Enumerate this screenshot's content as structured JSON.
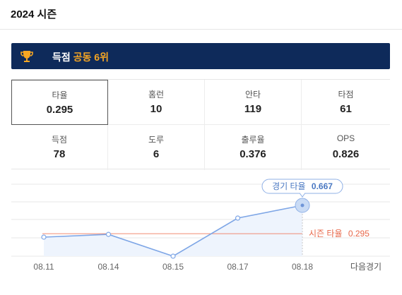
{
  "header": {
    "title": "2024 시즌"
  },
  "rank": {
    "prefix": "득점",
    "tie": "공동 6위",
    "icon": "trophy-icon"
  },
  "stats": [
    {
      "label": "타율",
      "value": "0.295",
      "active": true
    },
    {
      "label": "홈런",
      "value": "10"
    },
    {
      "label": "안타",
      "value": "119"
    },
    {
      "label": "타점",
      "value": "61"
    },
    {
      "label": "득점",
      "value": "78"
    },
    {
      "label": "도루",
      "value": "6"
    },
    {
      "label": "출루율",
      "value": "0.376"
    },
    {
      "label": "OPS",
      "value": "0.826"
    }
  ],
  "chart_data": {
    "type": "line",
    "x": [
      "08.11",
      "08.14",
      "08.15",
      "08.17",
      "08.18"
    ],
    "series": [
      {
        "values": [
          0.25,
          0.286,
          0.0,
          0.5,
          0.667
        ]
      }
    ],
    "season_avg": {
      "label": "시즌 타율",
      "value": 0.295
    },
    "tooltip": {
      "label": "경기 타율",
      "value": "0.667"
    },
    "next_label": "다음경기",
    "ylim": [
      0,
      1
    ],
    "colors": {
      "line": "#7ea6e6",
      "fill": "#eef4fd",
      "avg": "#f08a72"
    }
  }
}
